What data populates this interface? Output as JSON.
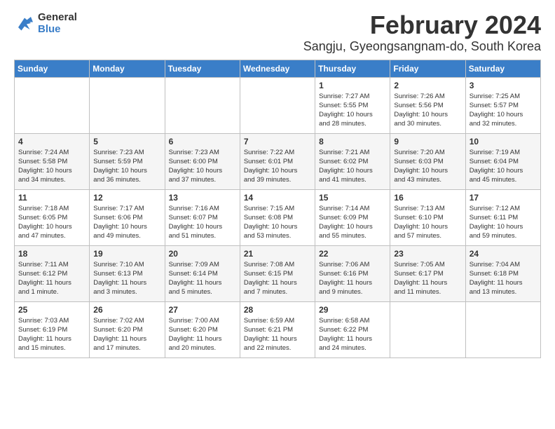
{
  "logo": {
    "line1": "General",
    "line2": "Blue"
  },
  "title": "February 2024",
  "subtitle": "Sangju, Gyeongsangnam-do, South Korea",
  "days_header": [
    "Sunday",
    "Monday",
    "Tuesday",
    "Wednesday",
    "Thursday",
    "Friday",
    "Saturday"
  ],
  "weeks": [
    [
      {
        "day": "",
        "info": ""
      },
      {
        "day": "",
        "info": ""
      },
      {
        "day": "",
        "info": ""
      },
      {
        "day": "",
        "info": ""
      },
      {
        "day": "1",
        "info": "Sunrise: 7:27 AM\nSunset: 5:55 PM\nDaylight: 10 hours\nand 28 minutes."
      },
      {
        "day": "2",
        "info": "Sunrise: 7:26 AM\nSunset: 5:56 PM\nDaylight: 10 hours\nand 30 minutes."
      },
      {
        "day": "3",
        "info": "Sunrise: 7:25 AM\nSunset: 5:57 PM\nDaylight: 10 hours\nand 32 minutes."
      }
    ],
    [
      {
        "day": "4",
        "info": "Sunrise: 7:24 AM\nSunset: 5:58 PM\nDaylight: 10 hours\nand 34 minutes."
      },
      {
        "day": "5",
        "info": "Sunrise: 7:23 AM\nSunset: 5:59 PM\nDaylight: 10 hours\nand 36 minutes."
      },
      {
        "day": "6",
        "info": "Sunrise: 7:23 AM\nSunset: 6:00 PM\nDaylight: 10 hours\nand 37 minutes."
      },
      {
        "day": "7",
        "info": "Sunrise: 7:22 AM\nSunset: 6:01 PM\nDaylight: 10 hours\nand 39 minutes."
      },
      {
        "day": "8",
        "info": "Sunrise: 7:21 AM\nSunset: 6:02 PM\nDaylight: 10 hours\nand 41 minutes."
      },
      {
        "day": "9",
        "info": "Sunrise: 7:20 AM\nSunset: 6:03 PM\nDaylight: 10 hours\nand 43 minutes."
      },
      {
        "day": "10",
        "info": "Sunrise: 7:19 AM\nSunset: 6:04 PM\nDaylight: 10 hours\nand 45 minutes."
      }
    ],
    [
      {
        "day": "11",
        "info": "Sunrise: 7:18 AM\nSunset: 6:05 PM\nDaylight: 10 hours\nand 47 minutes."
      },
      {
        "day": "12",
        "info": "Sunrise: 7:17 AM\nSunset: 6:06 PM\nDaylight: 10 hours\nand 49 minutes."
      },
      {
        "day": "13",
        "info": "Sunrise: 7:16 AM\nSunset: 6:07 PM\nDaylight: 10 hours\nand 51 minutes."
      },
      {
        "day": "14",
        "info": "Sunrise: 7:15 AM\nSunset: 6:08 PM\nDaylight: 10 hours\nand 53 minutes."
      },
      {
        "day": "15",
        "info": "Sunrise: 7:14 AM\nSunset: 6:09 PM\nDaylight: 10 hours\nand 55 minutes."
      },
      {
        "day": "16",
        "info": "Sunrise: 7:13 AM\nSunset: 6:10 PM\nDaylight: 10 hours\nand 57 minutes."
      },
      {
        "day": "17",
        "info": "Sunrise: 7:12 AM\nSunset: 6:11 PM\nDaylight: 10 hours\nand 59 minutes."
      }
    ],
    [
      {
        "day": "18",
        "info": "Sunrise: 7:11 AM\nSunset: 6:12 PM\nDaylight: 11 hours\nand 1 minute."
      },
      {
        "day": "19",
        "info": "Sunrise: 7:10 AM\nSunset: 6:13 PM\nDaylight: 11 hours\nand 3 minutes."
      },
      {
        "day": "20",
        "info": "Sunrise: 7:09 AM\nSunset: 6:14 PM\nDaylight: 11 hours\nand 5 minutes."
      },
      {
        "day": "21",
        "info": "Sunrise: 7:08 AM\nSunset: 6:15 PM\nDaylight: 11 hours\nand 7 minutes."
      },
      {
        "day": "22",
        "info": "Sunrise: 7:06 AM\nSunset: 6:16 PM\nDaylight: 11 hours\nand 9 minutes."
      },
      {
        "day": "23",
        "info": "Sunrise: 7:05 AM\nSunset: 6:17 PM\nDaylight: 11 hours\nand 11 minutes."
      },
      {
        "day": "24",
        "info": "Sunrise: 7:04 AM\nSunset: 6:18 PM\nDaylight: 11 hours\nand 13 minutes."
      }
    ],
    [
      {
        "day": "25",
        "info": "Sunrise: 7:03 AM\nSunset: 6:19 PM\nDaylight: 11 hours\nand 15 minutes."
      },
      {
        "day": "26",
        "info": "Sunrise: 7:02 AM\nSunset: 6:20 PM\nDaylight: 11 hours\nand 17 minutes."
      },
      {
        "day": "27",
        "info": "Sunrise: 7:00 AM\nSunset: 6:20 PM\nDaylight: 11 hours\nand 20 minutes."
      },
      {
        "day": "28",
        "info": "Sunrise: 6:59 AM\nSunset: 6:21 PM\nDaylight: 11 hours\nand 22 minutes."
      },
      {
        "day": "29",
        "info": "Sunrise: 6:58 AM\nSunset: 6:22 PM\nDaylight: 11 hours\nand 24 minutes."
      },
      {
        "day": "",
        "info": ""
      },
      {
        "day": "",
        "info": ""
      }
    ]
  ]
}
